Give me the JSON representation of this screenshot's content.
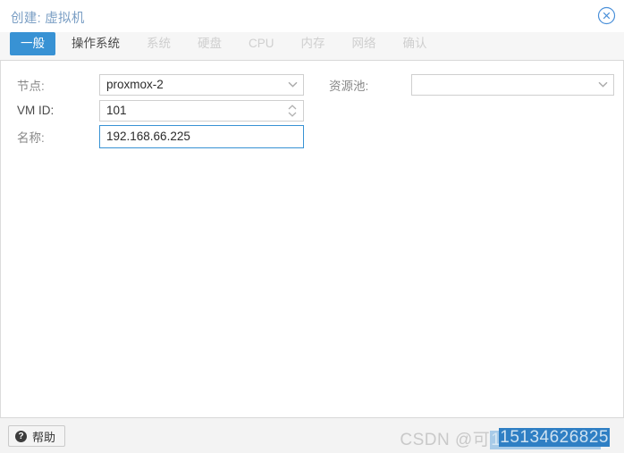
{
  "dialog": {
    "title": "创建: 虚拟机",
    "close_icon": "close-circle-icon"
  },
  "tabs": [
    {
      "label": "一般",
      "state": "active"
    },
    {
      "label": "操作系统",
      "state": "enabled"
    },
    {
      "label": "系统",
      "state": "disabled"
    },
    {
      "label": "硬盘",
      "state": "disabled"
    },
    {
      "label": "CPU",
      "state": "disabled"
    },
    {
      "label": "内存",
      "state": "disabled"
    },
    {
      "label": "网络",
      "state": "disabled"
    },
    {
      "label": "确认",
      "state": "disabled"
    }
  ],
  "form": {
    "left": {
      "node": {
        "label": "节点:",
        "value": "proxmox-2",
        "type": "combobox",
        "icon": "chevron-down-icon"
      },
      "vmid": {
        "label": "VM ID:",
        "value": "101",
        "type": "spinner",
        "icon": "spinner-arrows-icon"
      },
      "name": {
        "label": "名称:",
        "value": "192.168.66.225",
        "placeholder": "",
        "type": "textfield",
        "focused": true
      }
    },
    "right": {
      "pool": {
        "label": "资源池:",
        "value": "",
        "placeholder": "",
        "type": "combobox",
        "icon": "chevron-down-icon"
      }
    }
  },
  "footer": {
    "help_label": "帮助",
    "help_icon": "question-mark-icon",
    "watermark_primary": "CSDN @可",
    "watermark_secondary_a": "15134626825",
    "watermark_secondary_b": "15134626825"
  },
  "colors": {
    "accent": "#3892d4",
    "title_text": "#7a9ec4",
    "tab_disabled": "#cfcfcf",
    "field_border": "#cfcfcf",
    "footer_bg": "#f3f3f3"
  }
}
